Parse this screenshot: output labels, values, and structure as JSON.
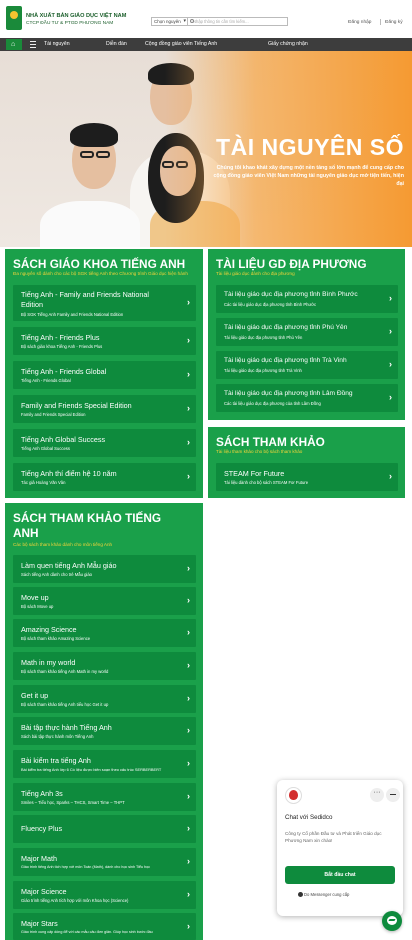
{
  "header": {
    "brand_line1": "NHÀ XUẤT BẢN GIÁO DỤC VIỆT NAM",
    "brand_line2": "CTCP ĐẦU TƯ & PTGD PHƯƠNG NAM",
    "select_value": "Chọn nguyên",
    "search_placeholder": "Nhập thông tin cần tìm kiếm...",
    "login": "Đăng nhập",
    "register": "Đăng ký"
  },
  "nav": {
    "items": [
      "Tài nguyên",
      "Diễn đàn",
      "Cộng đồng giáo viên Tiếng Anh",
      "Giấy chứng nhận"
    ]
  },
  "hero": {
    "title": "TÀI NGUYÊN SỐ",
    "subtitle": "Chúng tôi khao khát xây dựng một nền tảng số lớn mạnh để cung cấp cho cộng đồng giáo viên Việt Nam những tài nguyên giáo dục mở tiện tiến, hiện đại"
  },
  "sgk": {
    "title": "SÁCH GIÁO KHOA TIẾNG ANH",
    "subtitle": "Đa nguyên số dành cho các bộ SGK tiếng Anh theo Chương trình Giáo dục hiện hành",
    "items": [
      {
        "title": "Tiếng Anh - Family and Friends National",
        "title2": "Edition",
        "sub": "Bộ SGK Tiếng Anh Family and Friends National Edition"
      },
      {
        "title": "Tiếng Anh - Friends Plus",
        "sub": "Bộ sách giáo khoa Tiếng Anh - Friends Plus"
      },
      {
        "title": "Tiếng Anh - Friends Global",
        "sub": "Tiếng Anh - Friends Global"
      },
      {
        "title": "Family and Friends Special Edition",
        "sub": "Family and Friends Special Edition"
      },
      {
        "title": "Tiếng Anh Global Success",
        "sub": "Tiếng Anh Global Success"
      },
      {
        "title": "Tiếng Anh thí điểm hệ 10 năm",
        "sub": "Tác giả Hoàng Văn Vân"
      }
    ]
  },
  "gddp": {
    "title": "TÀI LIỆU GD ĐỊA PHƯƠNG",
    "subtitle": "Tài liệu giáo dục dành cho địa phương",
    "items": [
      {
        "title": "Tài liệu giáo dục địa phương tỉnh Bình Phước",
        "sub": "Các tài liệu giáo dục địa phương tỉnh Bình Phước"
      },
      {
        "title": "Tài liệu giáo dục địa phương tỉnh Phú Yên",
        "sub": "Tài liệu giáo dục địa phương tỉnh Phú Yên"
      },
      {
        "title": "Tài liệu giáo dục địa phương tỉnh Trà Vinh",
        "sub": "Tài liệu giáo dục địa phương tỉnh Trà Vinh"
      },
      {
        "title": "Tài liệu giáo dục địa phương tỉnh Lâm Đồng",
        "sub": "Các tài liệu giáo dục địa phương của tỉnh Lâm Đồng"
      }
    ]
  },
  "stk": {
    "title": "SÁCH THAM KHẢO",
    "subtitle": "Tài liệu tham khảo cho bộ sách tham khảo",
    "items": [
      {
        "title": "STEAM For Future",
        "sub": "Tài liệu dành cho bộ sách STEAM For Future"
      }
    ]
  },
  "stkta": {
    "title_line1": "SÁCH THAM KHẢO TIẾNG",
    "title_line2": "ANH",
    "subtitle": "Các bộ sách tham khảo dành cho môn tiếng Anh",
    "items": [
      {
        "title": "Làm quen tiếng Anh Mẫu giáo",
        "sub": "Sách tiếng Anh dành cho trẻ Mẫu giáo"
      },
      {
        "title": "Move up",
        "sub": "Bộ sách Move up"
      },
      {
        "title": "Amazing Science",
        "sub": "Bộ sách tham khảo Amazing Science"
      },
      {
        "title": "Math in my world",
        "sub": "Bộ sách tham khảo tiếng Anh Math in my world"
      },
      {
        "title": "Get it up",
        "sub": "Bộ sách tham khảo tiếng Anh tiểu học Get it up"
      },
      {
        "title": "Bài tập thực hành Tiếng Anh",
        "sub": "Sách bài tập thực hành môn Tiếng Anh"
      },
      {
        "title": "Bài kiểm tra tiếng Anh",
        "sub": "Bài kiểm tra tiếng Anh lớp 6 Có liệu được biên soạn theo cấu trúc SERBERBERT"
      },
      {
        "title": "Tiếng Anh 3s",
        "sub": "Smiles – Tiểu học, Sparks – THCS, Smart Time – THPT"
      },
      {
        "title": "Fluency Plus",
        "sub": ""
      },
      {
        "title": "Major Math",
        "sub": "Giáo trình tiếng Anh tích hợp với môn Toán (Math), dành cho học sinh Tiểu học"
      },
      {
        "title": "Major Science",
        "sub": "Giáo trình tiếng Anh tích hợp với môn Khoa học (Science)"
      },
      {
        "title": "Major Stars",
        "sub": "Giáo trình cung cấp dòng để với các mẫu câu đơn giản. Giúp học sinh bước đầu"
      }
    ]
  },
  "chat": {
    "title": "Chat với Sedidco",
    "message": "Công ty Cổ phần Đầu tư và Phát triển Giáo dục Phương Nam xin chào!",
    "button": "Bắt đầu chat",
    "footer": "Do Messenger cung cấp",
    "more": "···"
  },
  "colors": {
    "green_card": "#1aa04a",
    "green_item": "#0e8b3d",
    "orange_hero": "#f59a32",
    "nav_dark": "#3d3d3d",
    "subtitle_yellow": "#f4d43a"
  }
}
